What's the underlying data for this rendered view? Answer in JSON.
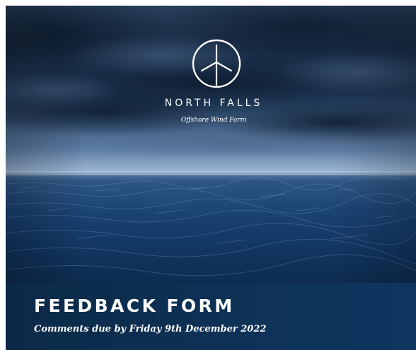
{
  "brand": {
    "name": "NORTH FALLS",
    "tagline": "Offshore Wind Farm",
    "logo_icon": "wind-turbine-icon"
  },
  "form": {
    "title": "FEEDBACK FORM",
    "deadline": "Comments due by Friday 9th December 2022"
  },
  "colors": {
    "band": "#0d2c4b",
    "text": "#ffffff",
    "sea": "#123a63",
    "sky": "#0f2a47"
  }
}
